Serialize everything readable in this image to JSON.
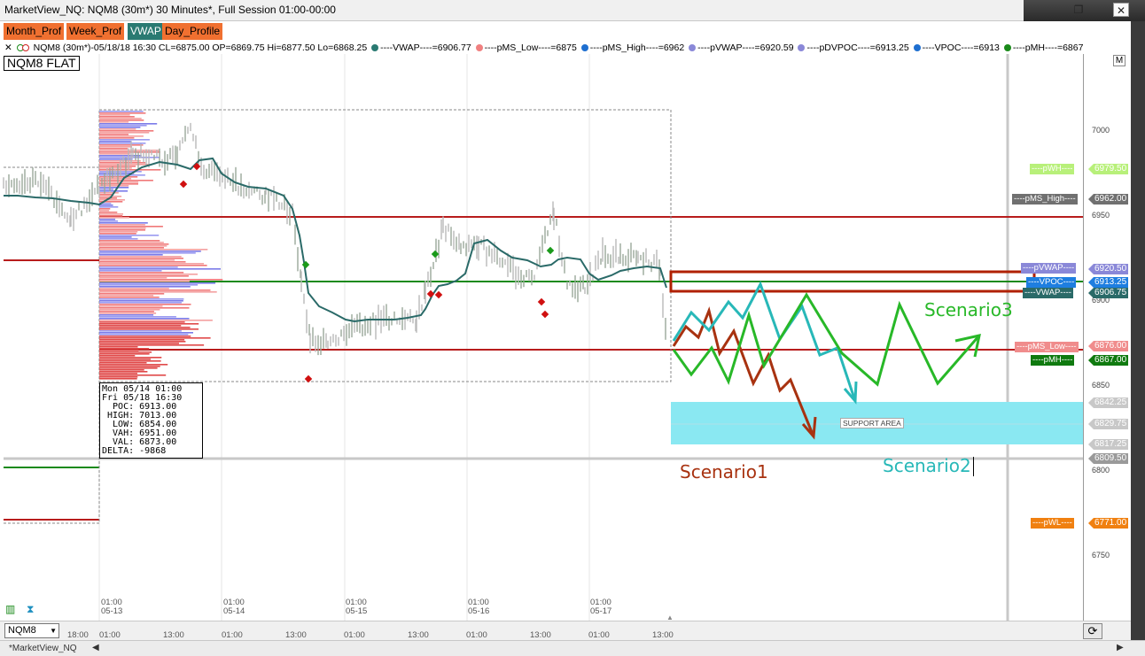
{
  "window": {
    "title": "MarketView_NQ: NQM8 (30m*) 30 Minutes*, Full Session 01:00-00:00",
    "restore_icon": "restore-icon",
    "close_icon": "close-icon"
  },
  "toolbar": {
    "buttons": [
      {
        "label": "Month_Prof",
        "color": "#f07030"
      },
      {
        "label": "Week_Prof",
        "color": "#f07030"
      },
      {
        "label": "VWAP",
        "color": "#2a7a72"
      },
      {
        "label": "Day_Profile",
        "color": "#f07030"
      }
    ]
  },
  "infobar": {
    "close_glyph": "✕",
    "instrument": "NQM8 (30m*)-05/18/18 16:30 CL=6875.00 OP=6869.75 Hi=6877.50 Lo=6868.25",
    "legend": [
      {
        "text": "----VWAP----=6906.77",
        "color": "#2a7a72"
      },
      {
        "text": "----pMS_Low----=6875",
        "color": "#f08080"
      },
      {
        "text": "----pMS_High----=6962",
        "color": "#1e6fd0"
      },
      {
        "text": "----pVWAP----=6920.59",
        "color": "#8a88d8"
      },
      {
        "text": "----pDVPOC----=6913.25",
        "color": "#8a88d8"
      },
      {
        "text": "----VPOC----=6913",
        "color": "#1e6fd0"
      },
      {
        "text": "----pMH----=6867",
        "color": "#1a8a1a"
      }
    ],
    "m_button": "M"
  },
  "chart": {
    "symbol_label": "NQM8 FLAT",
    "stats": {
      "lines": [
        "Mon 05/14 01:00",
        "Fri 05/18 16:30",
        "  POC: 6913.00",
        " HIGH: 7013.00",
        "  LOW: 6854.00",
        "  VAH: 6951.00",
        "  VAL: 6873.00",
        "DELTA: -9868"
      ]
    },
    "price_ticks": [
      "7000",
      "6950",
      "6900",
      "6850",
      "6800",
      "6750"
    ],
    "axis_tags": [
      {
        "label": "----pWH----",
        "value": "6979.50",
        "color": "#b8f07a",
        "text_color": "#fff"
      },
      {
        "label": "----pMS_High----",
        "value": "6962.00",
        "color": "#707070",
        "text_color": "#fff"
      },
      {
        "label": "----pVWAP----",
        "value": "6920.50",
        "color": "#8a88d8",
        "text_color": "#fff"
      },
      {
        "label": "----VPOC----",
        "value": "6913.25",
        "color": "#1e7ee0",
        "text_color": "#fff"
      },
      {
        "label": "----VWAP----",
        "value": "6906.75",
        "color": "#2a6a68",
        "text_color": "#fff"
      },
      {
        "label": "----pMS_Low----",
        "value": "6876.00",
        "color": "#f08c8c",
        "text_color": "#fff"
      },
      {
        "label": "----pMH----",
        "value": "6867.00",
        "color": "#0f7a0f",
        "text_color": "#fff"
      },
      {
        "label": "",
        "value": "6842.25",
        "color": "#c8c8c8",
        "text_color": "#fff"
      },
      {
        "label": "",
        "value": "6829.75",
        "color": "#c8c8c8",
        "text_color": "#fff"
      },
      {
        "label": "",
        "value": "6817.25",
        "color": "#c8c8c8",
        "text_color": "#fff"
      },
      {
        "label": "",
        "value": "6809.50",
        "color": "#9a9a9a",
        "text_color": "#fff"
      },
      {
        "label": "----pWL----",
        "value": "6771.00",
        "color": "#f08010",
        "text_color": "#fff"
      }
    ],
    "support_area_label": "SUPPORT AREA",
    "scenarios": {
      "s1": "Scenario1",
      "s2": "Scenario2",
      "s3": "Scenario3"
    },
    "day_labels": [
      {
        "time": "01:00",
        "date": "05-13"
      },
      {
        "time": "01:00",
        "date": "05-14"
      },
      {
        "time": "01:00",
        "date": "05-15"
      },
      {
        "time": "01:00",
        "date": "05-16"
      },
      {
        "time": "01:00",
        "date": "05-17"
      }
    ],
    "time_axis": [
      "18:00",
      "01:00",
      "13:00",
      "01:00",
      "13:00",
      "01:00",
      "13:00",
      "01:00",
      "13:00",
      "01:00",
      "13:00"
    ]
  },
  "bottom": {
    "symbol": "NQM8",
    "refresh_icon": "refresh-icon"
  },
  "tabs": {
    "active": "*MarketView_NQ"
  }
}
